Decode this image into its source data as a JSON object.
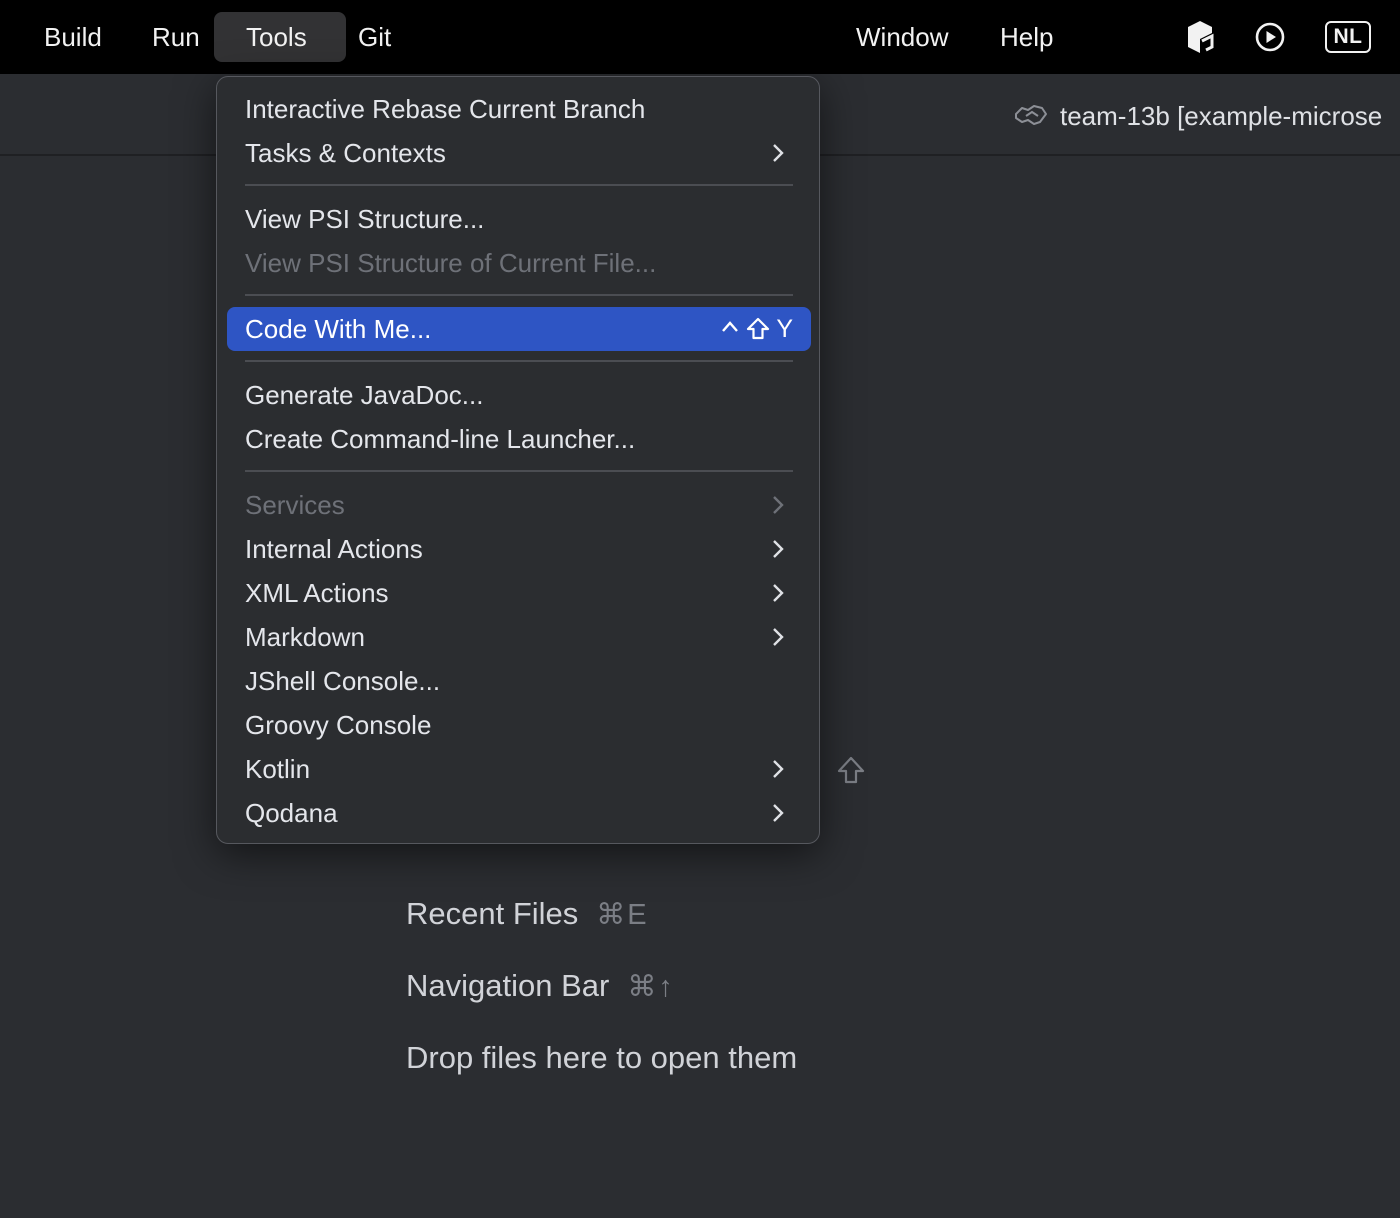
{
  "menubar": {
    "items": [
      {
        "label": "Build"
      },
      {
        "label": "Run"
      },
      {
        "label": "Tools"
      },
      {
        "label": "Git"
      },
      {
        "label": "Window"
      },
      {
        "label": "Help"
      }
    ],
    "active_item": "Tools",
    "status_items": [
      {
        "icon": "toolbox-app-icon"
      },
      {
        "icon": "play-circle-icon"
      },
      {
        "icon": "input-source-icon",
        "label": "NL"
      }
    ]
  },
  "toolbar": {
    "project": {
      "icon": "code-with-me-handshake-icon",
      "name": "team-13b [example-microse"
    }
  },
  "tools_menu": {
    "items": [
      {
        "label": "Interactive Rebase Current Branch",
        "enabled": true
      },
      {
        "label": "Tasks & Contexts",
        "enabled": true,
        "submenu": true
      },
      {
        "label": "View PSI Structure...",
        "enabled": true
      },
      {
        "label": "View PSI Structure of Current File...",
        "enabled": false
      },
      {
        "label": "Code With Me...",
        "enabled": true,
        "selected": true,
        "shortcut_key": "Y",
        "shortcut_modifiers": [
          "control",
          "shift"
        ]
      },
      {
        "label": "Generate JavaDoc...",
        "enabled": true
      },
      {
        "label": "Create Command-line Launcher...",
        "enabled": true
      },
      {
        "label": "Services",
        "enabled": false,
        "submenu": true
      },
      {
        "label": "Internal Actions",
        "enabled": true,
        "submenu": true
      },
      {
        "label": "XML Actions",
        "enabled": true,
        "submenu": true
      },
      {
        "label": "Markdown",
        "enabled": true,
        "submenu": true
      },
      {
        "label": "JShell Console...",
        "enabled": true
      },
      {
        "label": "Groovy Console",
        "enabled": true
      },
      {
        "label": "Kotlin",
        "enabled": true,
        "submenu": true
      },
      {
        "label": "Qodana",
        "enabled": true,
        "submenu": true
      }
    ]
  },
  "empty_state": {
    "hints": [
      {
        "label": "Recent Files",
        "shortcut": "⌘E"
      },
      {
        "label": "Navigation Bar",
        "shortcut": "⌘↑"
      },
      {
        "label": "Drop files here to open them",
        "shortcut": ""
      }
    ]
  },
  "colors": {
    "menubar_bg": "#000000",
    "ide_bg": "#2b2d31",
    "menu_bg": "#2b2d30",
    "selection": "#2e55c4",
    "disabled_text": "#6e7178"
  }
}
